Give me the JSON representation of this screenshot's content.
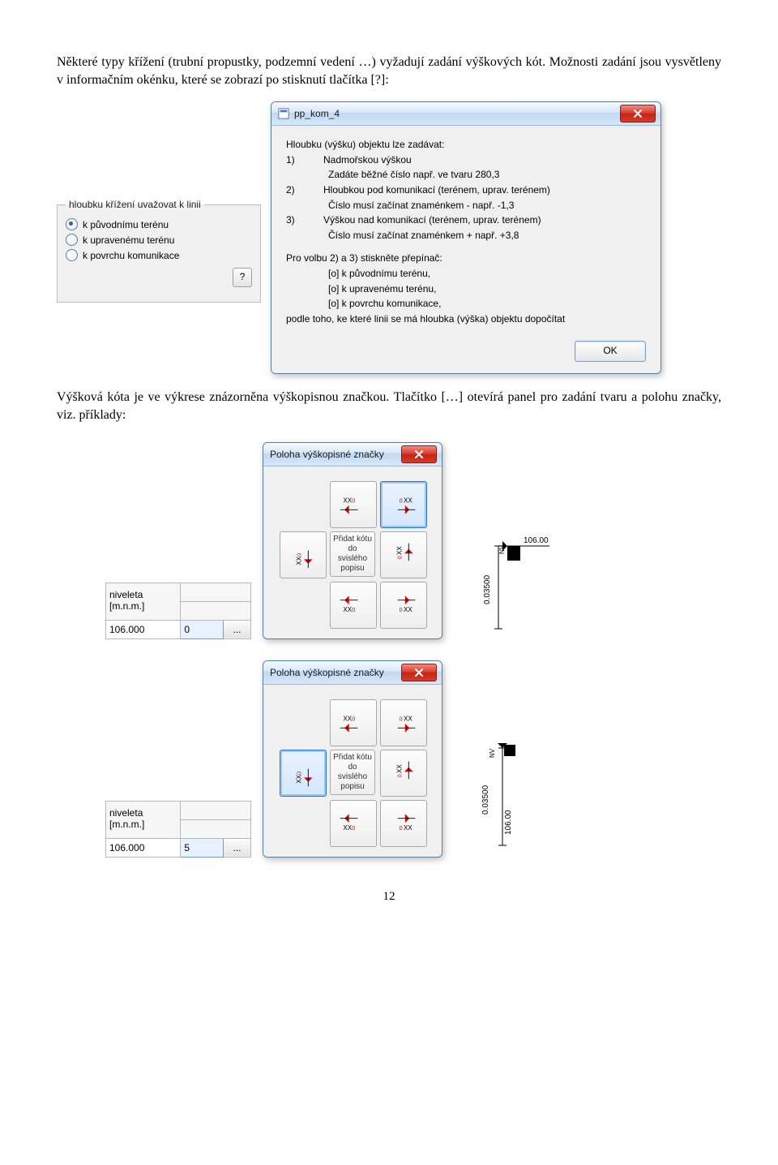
{
  "para1": "Některé typy křížení (trubní propustky, podzemní vedení …) vyžadují zadání výškových kót. Možnosti zadání jsou vysvětleny v informačním okénku, které se zobrazí po stisknutí tlačítka [?]:",
  "para2": "Výšková kóta je ve výkrese znázorněna výškopisnou značkou. Tlačítko […] otevírá panel pro zadání tvaru a polohu značky, viz. příklady:",
  "groupbox": {
    "legend": "hloubku křížení uvažovat k linii",
    "opt1": "k původnímu terénu",
    "opt2": "k upravenému terénu",
    "opt3": "k povrchu komunikace",
    "help": "?"
  },
  "info_dialog": {
    "title": "pp_kom_4",
    "heading": "Hloubku (výšku) objektu lze zadávat:",
    "n1": "1)",
    "n1a": "Nadmořskou výškou",
    "n1b": "Zadáte běžné číslo např. ve tvaru 280,3",
    "n2": "2)",
    "n2a": "Hloubkou pod komunikací (terénem, uprav. terénem)",
    "n2b": "Číslo musí začínat znaménkem - např. -1,3",
    "n3": "3)",
    "n3a": "Výškou nad komunikací (terénem, uprav. terénem)",
    "n3b": "Číslo musí začínat znaménkem + např. +3,8",
    "mid": "Pro volbu 2) a 3) stiskněte přepínač:",
    "mo1": "[o] k původnímu terénu,",
    "mo2": "[o] k upravenému terénu,",
    "mo3": "[o] k povrchu komunikace,",
    "tail": "podle toho, ke které linii se má hloubka (výška) objektu dopočítat",
    "ok": "OK"
  },
  "niveleta": {
    "h1": "niveleta",
    "h2": "[m.n.m.]",
    "value": "106.000",
    "poly_a": "0",
    "poly_b": "5",
    "ellipsis": "..."
  },
  "palette": {
    "title": "Poloha výškopisné značky",
    "center": "Přidat kótu do svislého popisu"
  },
  "schematic": {
    "top": "106.00",
    "nv": "NV",
    "side": "0.03500",
    "bottom": "106.00"
  },
  "page_number": "12"
}
